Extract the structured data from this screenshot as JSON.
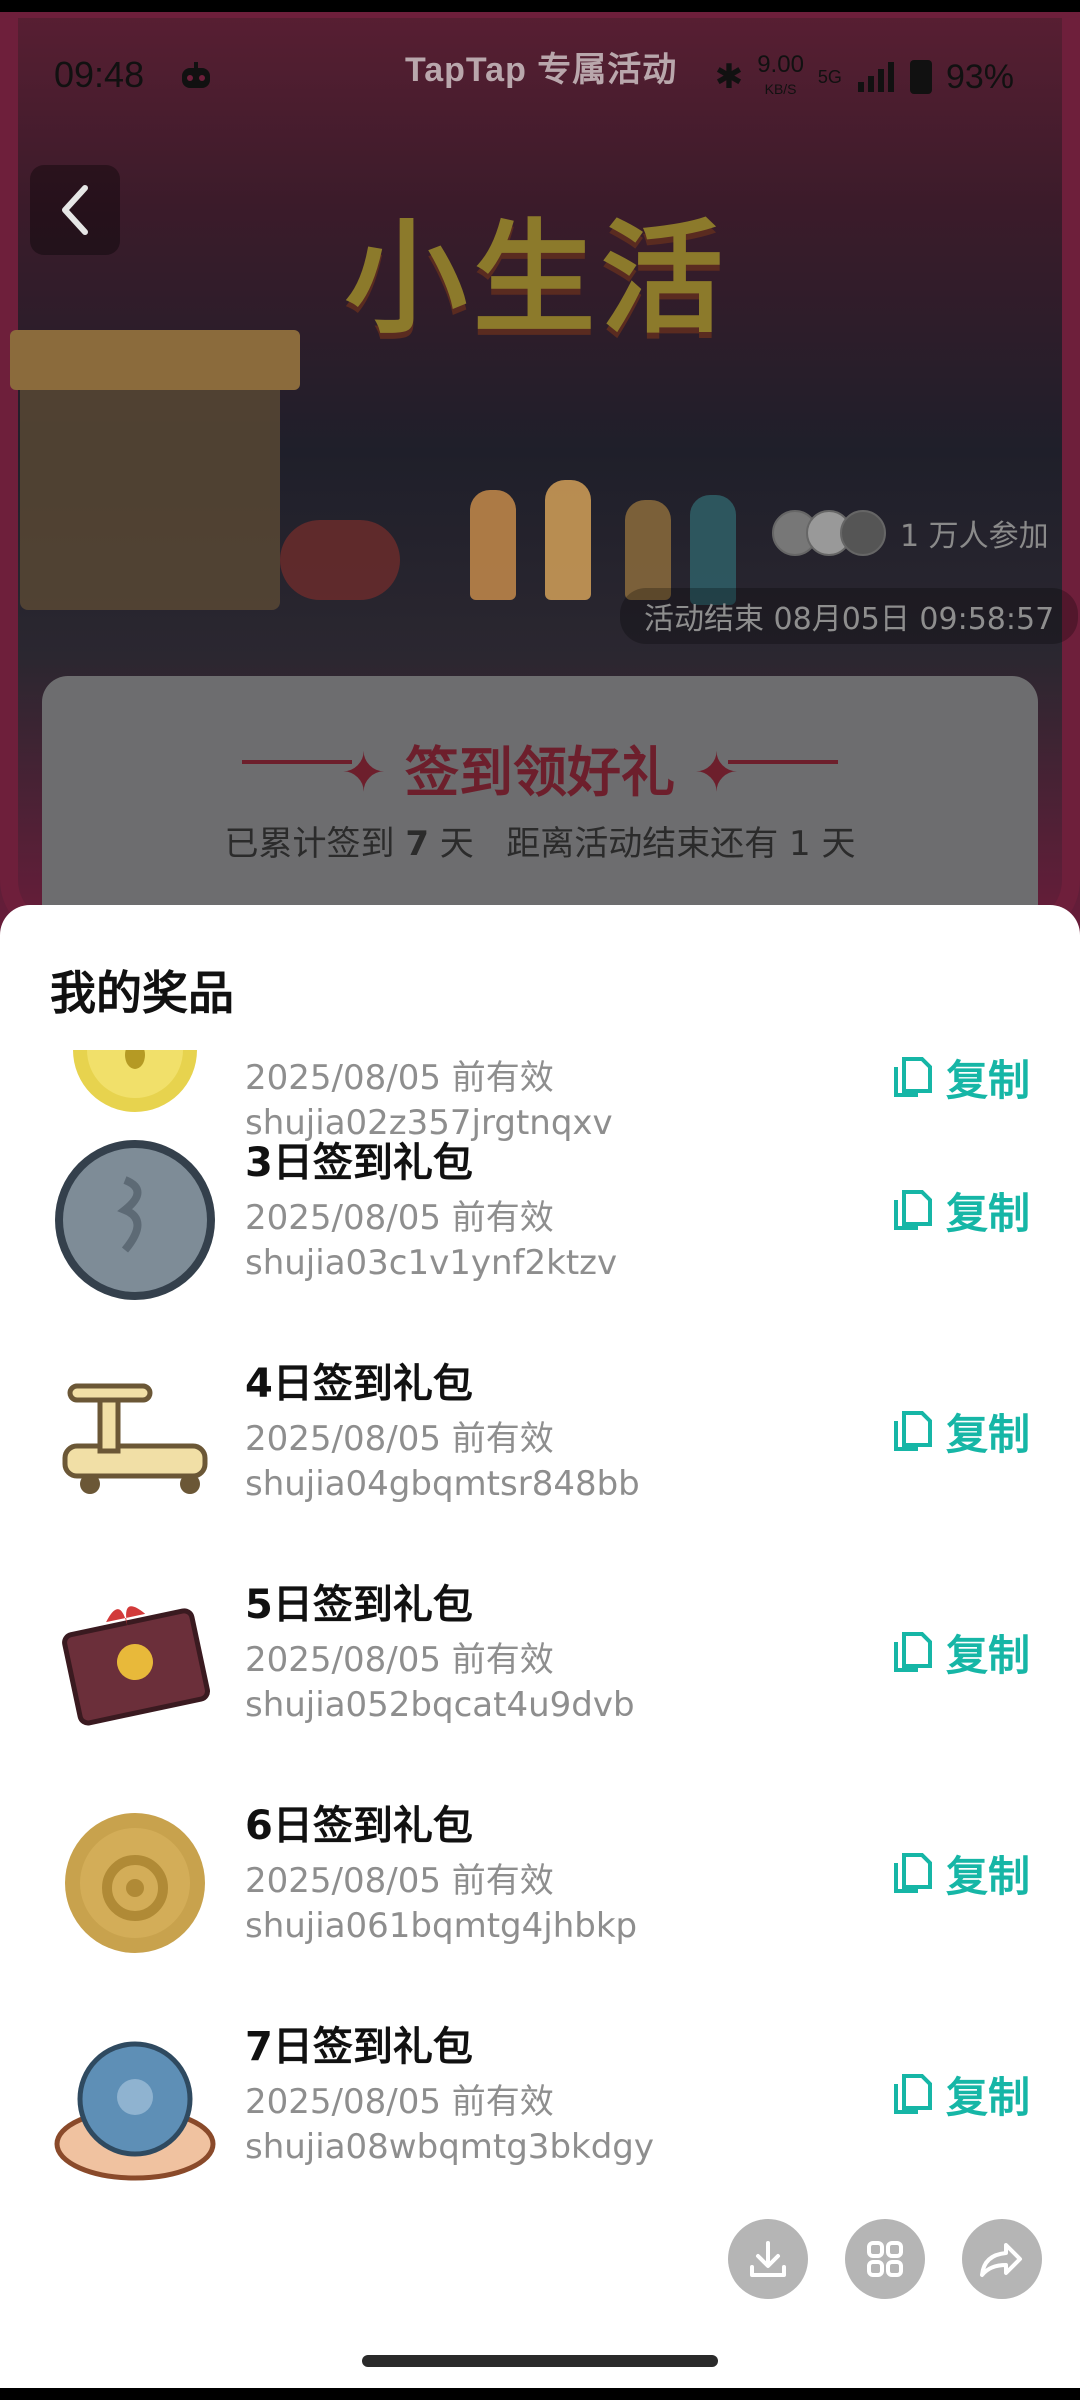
{
  "status_bar": {
    "time": "09:48",
    "center": "TapTap 专属活动",
    "network_speed": "9.00",
    "network_unit": "KB/S",
    "signal": "5G",
    "battery": "93%"
  },
  "event": {
    "title": "小生活",
    "participants": "1 万人参加",
    "ends_at": "活动结束 08月05日 09:58:57",
    "checkin": {
      "title": "签到领好礼",
      "signed_prefix": "已累计签到",
      "signed_days": "7",
      "signed_suffix": "天",
      "remaining_prefix": "距离活动结束还有",
      "remaining_days": "1",
      "remaining_suffix": "天"
    }
  },
  "sheet": {
    "title": "我的奖品",
    "copy_label": "复制",
    "items": [
      {
        "name": "",
        "valid": "2025/08/05 前有效",
        "code": "shujia02z357jrgtnqxv",
        "icon": "gold-coin-icon"
      },
      {
        "name": "3日签到礼包",
        "valid": "2025/08/05 前有效",
        "code": "shujia03c1v1ynf2ktzv",
        "icon": "silver-coin-icon"
      },
      {
        "name": "4日签到礼包",
        "valid": "2025/08/05 前有效",
        "code": "shujia04gbqmtsr848bb",
        "icon": "scooter-icon"
      },
      {
        "name": "5日签到礼包",
        "valid": "2025/08/05 前有效",
        "code": "shujia052bqcat4u9dvb",
        "icon": "red-envelope-icon"
      },
      {
        "name": "6日签到礼包",
        "valid": "2025/08/05 前有效",
        "code": "shujia061bqmtg4jhbkp",
        "icon": "bronze-medal-icon"
      },
      {
        "name": "7日签到礼包",
        "valid": "2025/08/05 前有效",
        "code": "shujia08wbqmtg3bkdgy",
        "icon": "crystal-ball-icon"
      }
    ]
  },
  "colors": {
    "accent": "#16b6a6",
    "sheet_bg": "#ffffff",
    "muted_text": "#8e8e8e"
  }
}
